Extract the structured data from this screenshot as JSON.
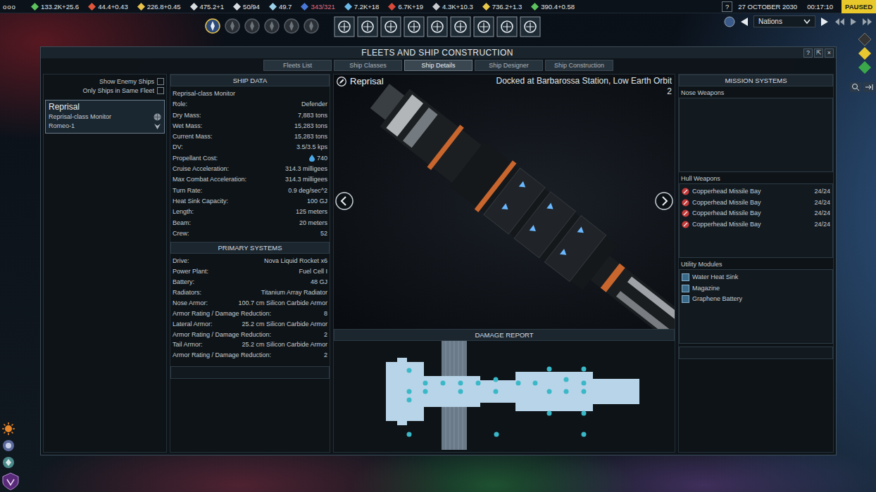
{
  "top_bar": {
    "menu": "ooo",
    "resources": [
      {
        "value": "133.2K+25.6",
        "color": "#5ec25e",
        "over": false
      },
      {
        "value": "44.4+0.43",
        "color": "#e0563a",
        "over": false
      },
      {
        "value": "226.8+0.45",
        "color": "#e8c24a",
        "over": false
      },
      {
        "value": "475.2+1",
        "color": "#d8dde2",
        "over": false
      },
      {
        "value": "50/94",
        "color": "#d8dde2",
        "over": false
      },
      {
        "value": "49.7",
        "color": "#9ad0e8",
        "over": false
      },
      {
        "value": "343/321",
        "color": "#4a78d8",
        "over": true
      },
      {
        "value": "7.2K+18",
        "color": "#6ab8e8",
        "over": false
      },
      {
        "value": "6.7K+19",
        "color": "#d84a3a",
        "over": false
      },
      {
        "value": "4.3K+10.3",
        "color": "#c8ccd0",
        "over": false
      },
      {
        "value": "736.2+1.3",
        "color": "#e8c84a",
        "over": false
      },
      {
        "value": "390.4+0.58",
        "color": "#5ec25e",
        "over": false
      }
    ],
    "help": "?",
    "date": "27 OCTOBER 2030",
    "time": "00:17:10",
    "status": "PAUSED"
  },
  "nav": {
    "factions": [
      {
        "selected": true
      },
      {
        "selected": false
      },
      {
        "selected": false
      },
      {
        "selected": false
      },
      {
        "selected": false
      },
      {
        "selected": false
      }
    ],
    "dropdown": "Nations"
  },
  "window": {
    "title": "FLEETS AND SHIP CONSTRUCTION",
    "controls": [
      "?",
      "⇱",
      "×"
    ]
  },
  "tabs": [
    {
      "label": "Fleets List",
      "selected": false
    },
    {
      "label": "Ship Classes",
      "selected": false
    },
    {
      "label": "Ship Details",
      "selected": true
    },
    {
      "label": "Ship Designer",
      "selected": false
    },
    {
      "label": "Ship Construction",
      "selected": false
    }
  ],
  "filters": [
    {
      "label": "Show Enemy Ships",
      "checked": false
    },
    {
      "label": "Only Ships in Same Fleet",
      "checked": false
    }
  ],
  "ships": [
    {
      "name": "Reprisal",
      "class": "Reprisal-class Monitor",
      "fleet": "Romeo-1",
      "selected": true
    }
  ],
  "ship_data": {
    "title": "SHIP DATA",
    "rows": [
      {
        "label": "Reprisal-class Monitor",
        "value": "",
        "kind": "text"
      },
      {
        "label": "Role:",
        "value": "Defender",
        "kind": "text"
      },
      {
        "label": "Dry Mass:",
        "value": "7,883 tons",
        "kind": "text"
      },
      {
        "label": "Wet Mass:",
        "value": "15,283 tons",
        "kind": "text"
      },
      {
        "label": "Current Mass:",
        "value": "15,283 tons",
        "kind": "text"
      },
      {
        "label": "DV:",
        "value": "3.5/3.5 kps",
        "kind": "text"
      },
      {
        "label": "Propellant Cost:",
        "value": "740",
        "kind": "cost"
      },
      {
        "label": "Cruise Acceleration:",
        "value": "314.3 milligees",
        "kind": "text"
      },
      {
        "label": "Max Combat Acceleration:",
        "value": "314.3 milligees",
        "kind": "text"
      },
      {
        "label": "Turn Rate:",
        "value": "0.9 deg/sec^2",
        "kind": "text"
      },
      {
        "label": "Heat Sink Capacity:",
        "value": "100 GJ",
        "kind": "text"
      },
      {
        "label": "Length:",
        "value": "125 meters",
        "kind": "text"
      },
      {
        "label": "Beam:",
        "value": "20 meters",
        "kind": "text"
      },
      {
        "label": "Crew:",
        "value": "52",
        "kind": "text"
      }
    ]
  },
  "primary_systems": {
    "title": "PRIMARY SYSTEMS",
    "rows": [
      {
        "label": "Drive:",
        "value": "Nova Liquid Rocket x6"
      },
      {
        "label": "Power Plant:",
        "value": "Fuel Cell I"
      },
      {
        "label": "Battery:",
        "value": "48 GJ"
      },
      {
        "label": "Radiators:",
        "value": "Titanium Array Radiator"
      },
      {
        "label": "Nose Armor:",
        "value": "100.7 cm Silicon Carbide Armor"
      },
      {
        "label": "Armor Rating / Damage Reduction:",
        "value": "8"
      },
      {
        "label": "Lateral Armor:",
        "value": "25.2 cm Silicon Carbide Armor"
      },
      {
        "label": "Armor Rating / Damage Reduction:",
        "value": "2"
      },
      {
        "label": "Tail Armor:",
        "value": "25.2 cm Silicon Carbide Armor"
      },
      {
        "label": "Armor Rating / Damage Reduction:",
        "value": "2"
      }
    ]
  },
  "ship_view": {
    "name": "Reprisal",
    "location": "Docked at Barbarossa Station, Low Earth Orbit 2"
  },
  "damage_report": {
    "title": "DAMAGE REPORT"
  },
  "mission_systems": {
    "title": "MISSION SYSTEMS",
    "groups": [
      {
        "label": "Nose Weapons",
        "items": []
      },
      {
        "label": "Hull Weapons",
        "items": [
          {
            "name": "Copperhead Missile Bay",
            "ammo": "24/24",
            "kind": "weapon"
          },
          {
            "name": "Copperhead Missile Bay",
            "ammo": "24/24",
            "kind": "weapon"
          },
          {
            "name": "Copperhead Missile Bay",
            "ammo": "24/24",
            "kind": "weapon"
          },
          {
            "name": "Copperhead Missile Bay",
            "ammo": "24/24",
            "kind": "weapon"
          }
        ]
      },
      {
        "label": "Utility Modules",
        "items": [
          {
            "name": "Water Heat Sink",
            "ammo": "",
            "kind": "module"
          },
          {
            "name": "Magazine",
            "ammo": "",
            "kind": "module"
          },
          {
            "name": "Graphene Battery",
            "ammo": "",
            "kind": "module"
          }
        ]
      }
    ]
  }
}
